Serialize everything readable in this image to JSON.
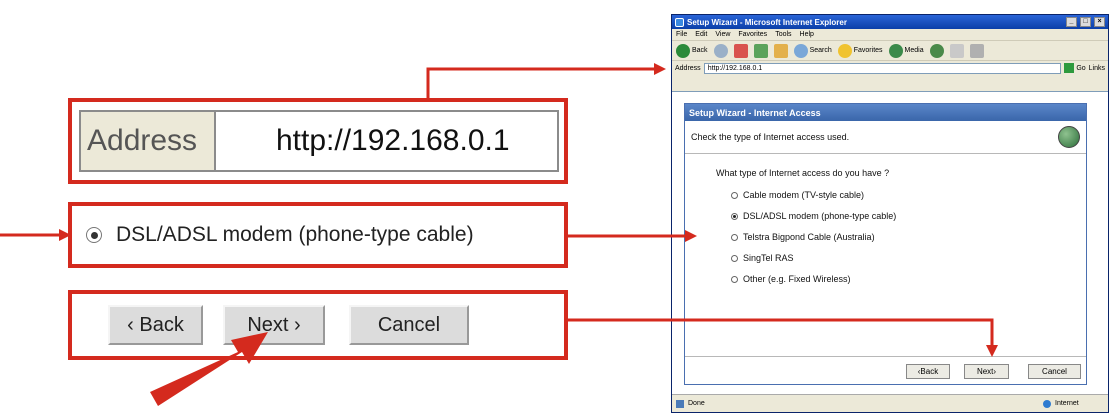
{
  "callouts": {
    "address_label": "Address",
    "address_value": "http://192.168.0.1",
    "radio_label": "DSL/ADSL modem (phone-type cable)",
    "back": "‹ Back",
    "next": "Next ›",
    "cancel": "Cancel"
  },
  "browser": {
    "title": "Setup Wizard - Microsoft Internet Explorer",
    "menu": [
      "File",
      "Edit",
      "View",
      "Favorites",
      "Tools",
      "Help"
    ],
    "toolbar": {
      "back": "Back",
      "search": "Search",
      "favorites": "Favorites",
      "media": "Media"
    },
    "address_label": "Address",
    "address_value": "http://192.168.0.1",
    "go": "Go",
    "links": "Links",
    "status_left": "Done",
    "status_right": "Internet"
  },
  "wizard": {
    "title": "Setup Wizard - Internet Access",
    "subtitle": "Check the type of Internet access used.",
    "question": "What type of Internet access do you have ?",
    "options": [
      "Cable modem (TV-style cable)",
      "DSL/ADSL modem (phone-type cable)",
      "Telstra Bigpond Cable (Australia)",
      "SingTel RAS",
      "Other (e.g. Fixed Wireless)"
    ],
    "selected_option": "DSL/ADSL modem (phone-type cable)",
    "back": "‹Back",
    "next": "Next›",
    "cancel": "Cancel"
  },
  "colors": {
    "callout": "#d42a1e",
    "title_bar": "#0b3fa8",
    "wizard_header": "#3a66aa"
  }
}
